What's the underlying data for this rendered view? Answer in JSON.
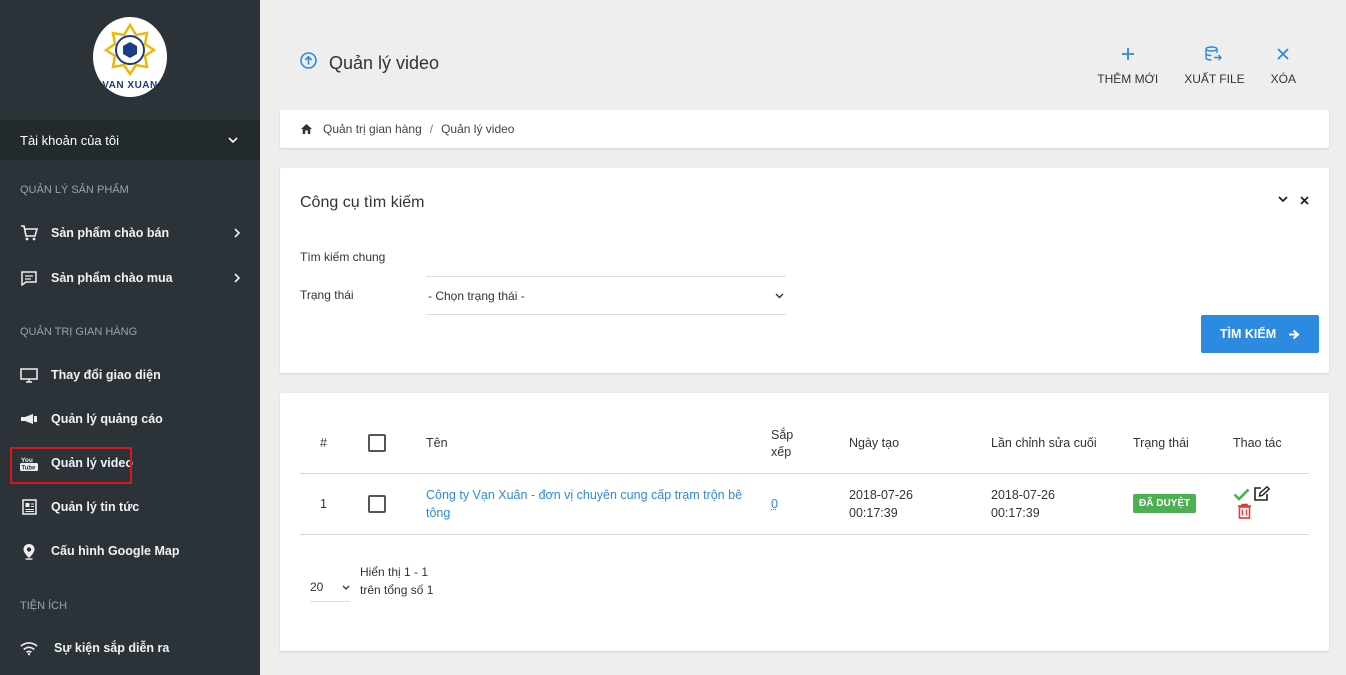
{
  "brand": {
    "logo_text": "VAN XUAN"
  },
  "sidebar": {
    "account": "Tài khoản của tôi",
    "sections": [
      "QUẢN LÝ SẢN PHẨM",
      "QUẢN TRỊ GIAN HÀNG",
      "TIỆN ÍCH"
    ],
    "items": [
      {
        "label": "Sản phẩm chào bán",
        "icon": "cart-icon"
      },
      {
        "label": "Sản phẩm chào mua",
        "icon": "chat-icon"
      },
      {
        "label": "Thay đổi giao diện",
        "icon": "monitor-icon"
      },
      {
        "label": "Quản lý quảng cáo",
        "icon": "megaphone-icon"
      },
      {
        "label": "Quản lý video",
        "icon": "youtube-icon",
        "active": true
      },
      {
        "label": "Quản lý tin tức",
        "icon": "news-icon"
      },
      {
        "label": "Cấu hình Google Map",
        "icon": "map-pin-icon"
      },
      {
        "label": "Sự kiện sắp diễn ra",
        "icon": "wifi-icon"
      }
    ]
  },
  "header": {
    "title": "Quản lý video",
    "actions": {
      "add": "THÊM MỚI",
      "export": "XUẤT FILE",
      "delete": "XÓA"
    }
  },
  "breadcrumb": {
    "home": "Quản trị gian hàng",
    "sep": "/",
    "current": "Quản lý video"
  },
  "search": {
    "title": "Công cụ tìm kiếm",
    "general_label": "Tìm kiếm chung",
    "status_label": "Trạng thái",
    "status_placeholder": "- Chọn trạng thái -",
    "button": "TÌM KIẾM"
  },
  "table": {
    "headers": {
      "index": "#",
      "name": "Tên",
      "sort_line1": "Sắp",
      "sort_line2": "xếp",
      "created": "Ngày tạo",
      "modified": "Lần chỉnh sửa cuối",
      "status": "Trạng thái",
      "actions": "Thao tác"
    },
    "rows": [
      {
        "index": "1",
        "name_line1": "Công ty Vạn Xuân - đơn vị chuyên cung cấp trạm trộn bê",
        "name_line2": "tông",
        "sort": "0",
        "created_date": "2018-07-26",
        "created_time": "00:17:39",
        "modified_date": "2018-07-26",
        "modified_time": "00:17:39",
        "status": "ĐÃ DUYỆT"
      }
    ],
    "page_size": "20",
    "summary_line1": "Hiển thị 1 - 1",
    "summary_line2": "trên tổng số 1"
  },
  "colors": {
    "sidebar": "#2b3338",
    "accent": "#2d8ae1",
    "approved": "#4caf50",
    "delete": "#e53935",
    "highlight": "#e0151b"
  }
}
